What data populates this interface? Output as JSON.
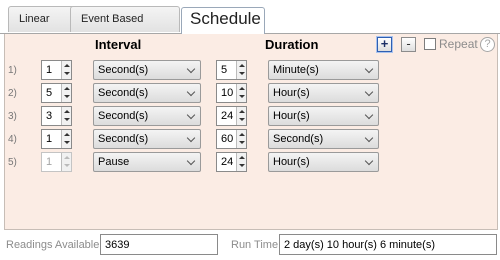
{
  "tabs": [
    {
      "label": "Linear",
      "active": false
    },
    {
      "label": "Event Based",
      "active": false
    },
    {
      "label": "Schedule",
      "active": true
    }
  ],
  "schedule": {
    "interval_header": "Interval",
    "duration_header": "Duration",
    "add_button": "+",
    "remove_button": "-",
    "repeat_label": "Repeat",
    "repeat_checked": false,
    "help_label": "?",
    "rows": [
      {
        "index": "1)",
        "interval_value": "1",
        "interval_unit": "Second(s)",
        "duration_value": "5",
        "duration_unit": "Minute(s)",
        "enabled": true
      },
      {
        "index": "2)",
        "interval_value": "5",
        "interval_unit": "Second(s)",
        "duration_value": "10",
        "duration_unit": "Hour(s)",
        "enabled": true
      },
      {
        "index": "3)",
        "interval_value": "3",
        "interval_unit": "Second(s)",
        "duration_value": "24",
        "duration_unit": "Hour(s)",
        "enabled": true
      },
      {
        "index": "4)",
        "interval_value": "1",
        "interval_unit": "Second(s)",
        "duration_value": "60",
        "duration_unit": "Second(s)",
        "enabled": true
      },
      {
        "index": "5)",
        "interval_value": "1",
        "interval_unit": "Pause",
        "duration_value": "24",
        "duration_unit": "Hour(s)",
        "enabled": false
      }
    ]
  },
  "status": {
    "readings_label": "Readings Available",
    "readings_value": "3639",
    "runtime_label": "Run Time",
    "runtime_value": "2 day(s) 10 hour(s) 6 minute(s)"
  },
  "colors": {
    "panel_background": "#fbece4",
    "label_gray": "#8c8c8c"
  }
}
